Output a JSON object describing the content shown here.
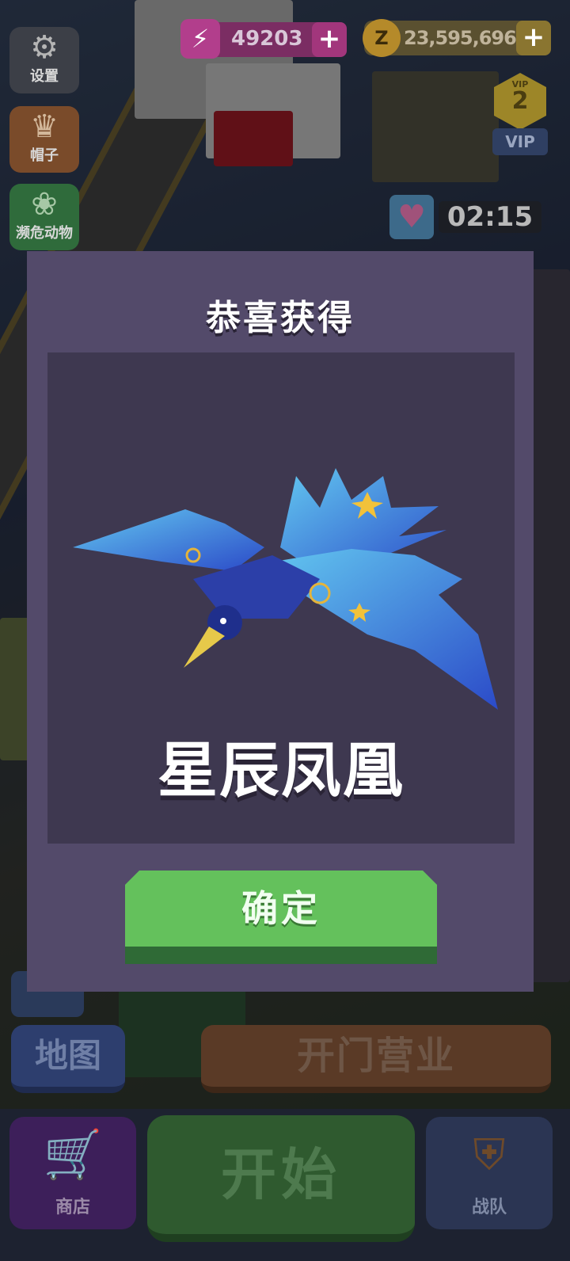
{
  "hud": {
    "energy_value": "49203",
    "coins_value": "23,595,696",
    "vip_small": "VIP",
    "vip_level": "2",
    "vip_label": "VIP",
    "timer": "02:15",
    "plus": "+"
  },
  "side_menu": [
    {
      "label": "设置",
      "icon": "gear-icon"
    },
    {
      "label": "帽子",
      "icon": "hat-icon"
    },
    {
      "label": "濒危动物",
      "icon": "paw-icon"
    }
  ],
  "bottom": {
    "map_label": "地图",
    "open_business_label": "开门营业",
    "shop_label": "商店",
    "start_label": "开始",
    "team_label": "战队"
  },
  "modal": {
    "title": "恭喜获得",
    "reward_name": "星辰凤凰",
    "confirm_label": "确定"
  },
  "colors": {
    "modal_bg": "#534a6a",
    "reward_bg": "#3e3850",
    "confirm_green": "#64c15c"
  }
}
